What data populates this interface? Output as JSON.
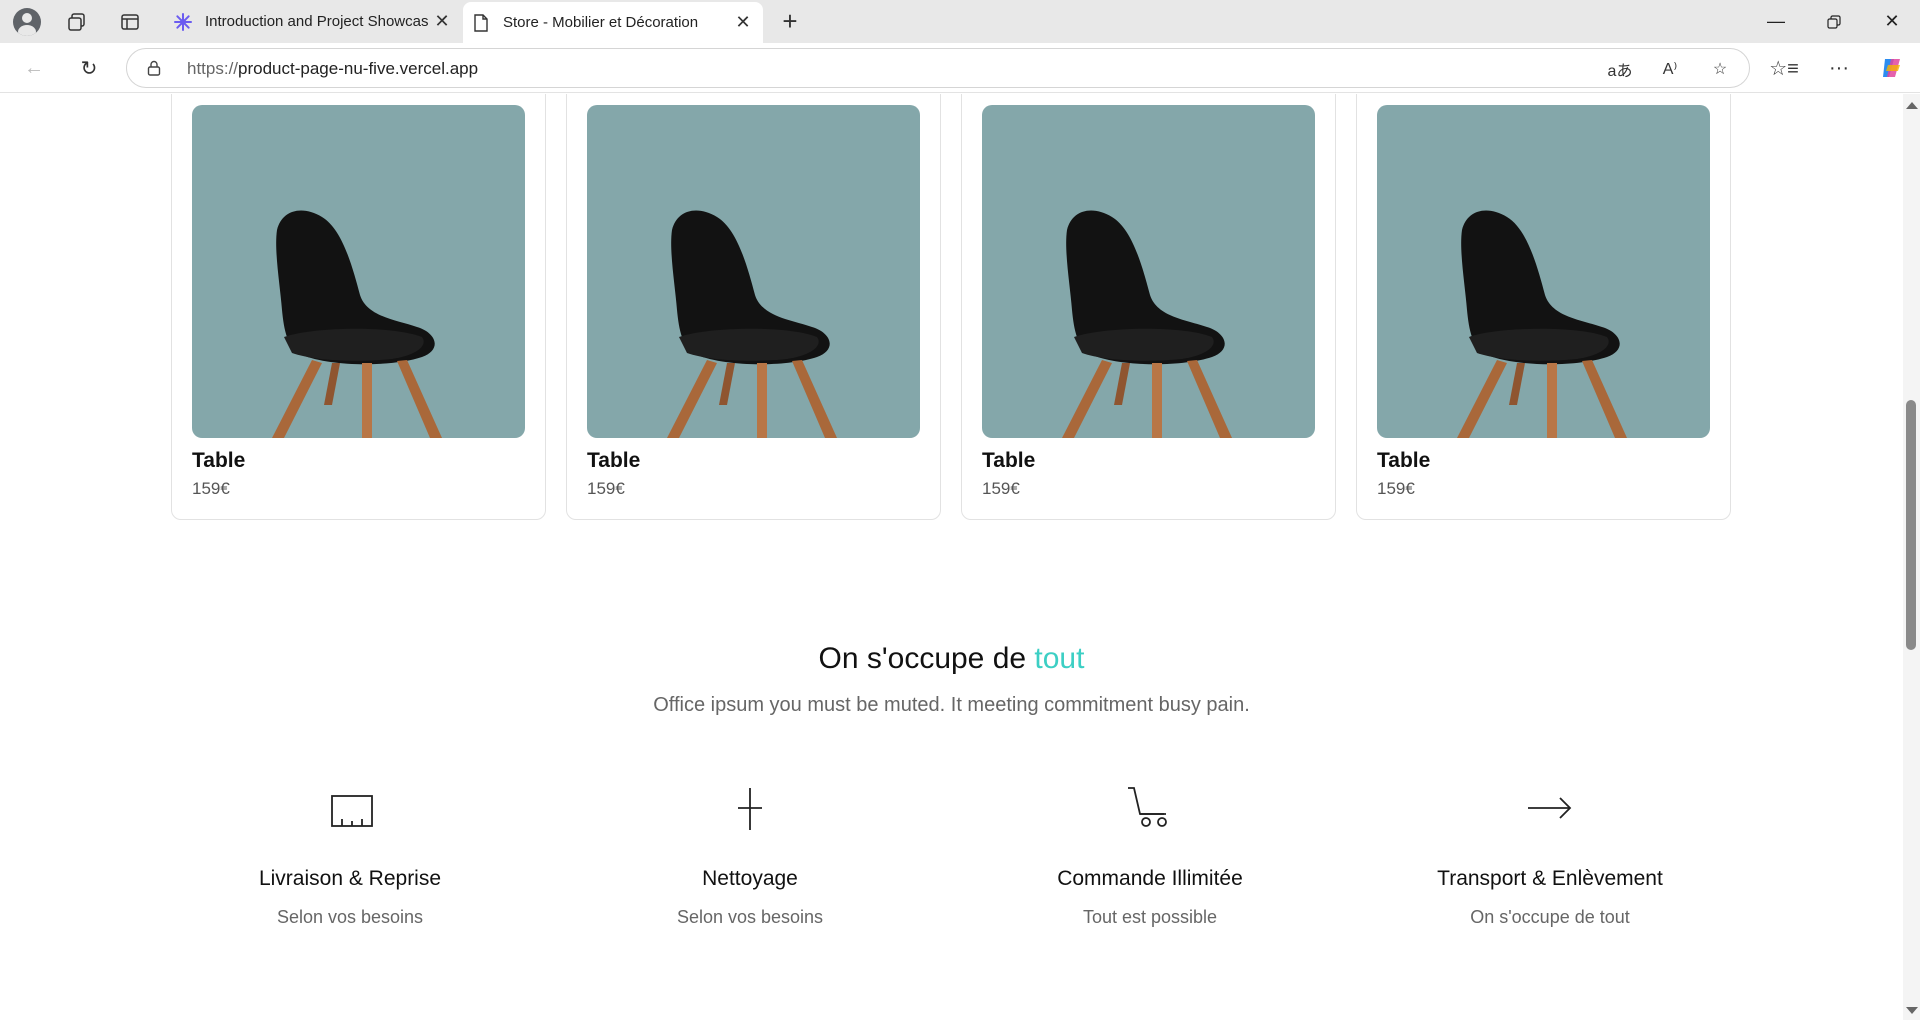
{
  "browser": {
    "tabs": [
      {
        "title": "Introduction and Project Showcas",
        "active": false,
        "favicon": "gear-flower-icon"
      },
      {
        "title": "Store - Mobilier et Décoration",
        "active": true,
        "favicon": "page-icon"
      }
    ],
    "url_prefix": "https://",
    "url_host": "product-page-nu-five.vercel.app"
  },
  "products": [
    {
      "name": "Table",
      "price": "159€"
    },
    {
      "name": "Table",
      "price": "159€"
    },
    {
      "name": "Table",
      "price": "159€"
    },
    {
      "name": "Table",
      "price": "159€"
    }
  ],
  "services": {
    "title_main": "On s'occupe de ",
    "title_accent": "tout",
    "accent_color": "#3ccfc4",
    "subtitle": "Office ipsum you must be muted. It meeting commitment busy pain.",
    "items": [
      {
        "icon": "ruler-box-icon",
        "title": "Livraison & Reprise",
        "subtitle": "Selon vos besoins"
      },
      {
        "icon": "plus-thin-icon",
        "title": "Nettoyage",
        "subtitle": "Selon vos besoins"
      },
      {
        "icon": "cart-icon",
        "title": "Commande Illimitée",
        "subtitle": "Tout est possible"
      },
      {
        "icon": "arrow-right-icon",
        "title": "Transport & Enlèvement",
        "subtitle": "On s'occupe de tout"
      }
    ]
  }
}
